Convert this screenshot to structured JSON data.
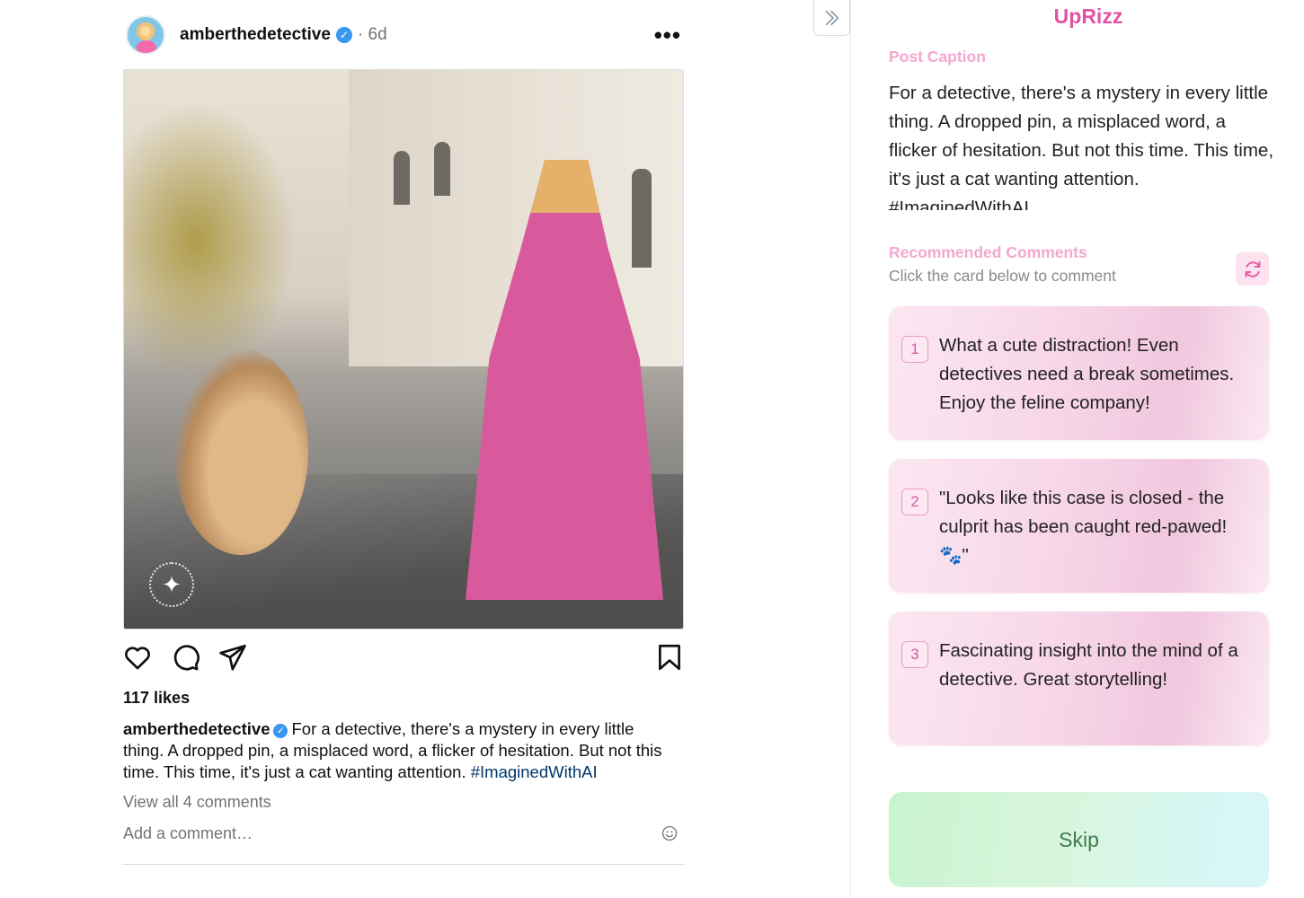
{
  "post": {
    "username": "amberthedetective",
    "time": "· 6d",
    "more_label": "•••",
    "likes": "117 likes",
    "caption_user": "amberthedetective",
    "caption_text": "For a detective, there's a mystery in every little thing. A dropped pin, a misplaced word, a flicker of hesitation. But not this time. This time, it's just a cat wanting attention.",
    "hashtag": "#ImaginedWithAI",
    "view_comments": "View all 4 comments",
    "add_comment_placeholder": "Add a comment…",
    "icons": [
      "heart-icon",
      "comment-icon",
      "share-icon",
      "bookmark-icon",
      "emoji-icon",
      "verified-badge-icon",
      "more-options-icon"
    ]
  },
  "panel": {
    "title": "UpRizz",
    "caption_label": "Post Caption",
    "caption_text": "For a detective, there's a mystery in every little thing. A dropped pin, a misplaced word, a flicker of hesitation. But not this time. This time, it's just a cat wanting attention. #ImaginedWithAI",
    "recommended_label": "Recommended Comments",
    "hint": "Click the card below to comment",
    "comments": [
      {
        "num": "1",
        "text": "What a cute distraction! Even detectives need a break sometimes. Enjoy the feline company!"
      },
      {
        "num": "2",
        "text": "\"Looks like this case is closed - the culprit has been caught red-pawed! 🐾\""
      },
      {
        "num": "3",
        "text": "Fascinating insight into the mind of a detective. Great storytelling!"
      }
    ],
    "skip_label": "Skip"
  },
  "colors": {
    "brand_pink": "#e054a6",
    "label_pink": "#f3a7cf",
    "verified_blue": "#3897f0",
    "hashtag_blue": "#00376b",
    "skip_green": "#c9f3cf"
  }
}
